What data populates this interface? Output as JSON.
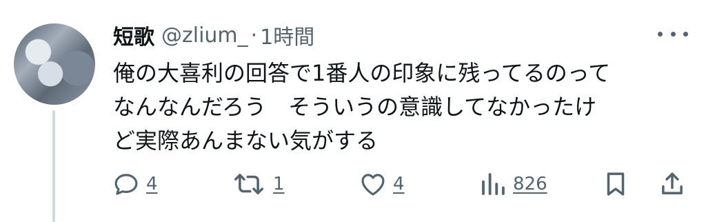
{
  "tweet": {
    "display_name": "短歌",
    "handle": "@zlium_",
    "separator": "·",
    "time": "1時間",
    "text": "俺の大喜利の回答で1番人の印象に残ってるのって\nなんなんだろう　そういうの意識してなかったけ\nど実際あんまない気がする"
  },
  "actions": {
    "reply_count": "4",
    "retweet_count": "1",
    "like_count": "4",
    "views_count": "826"
  },
  "icons": {
    "avatar": "avatar-image",
    "more": "more-options-icon",
    "reply": "reply-icon",
    "retweet": "retweet-icon",
    "like": "heart-icon",
    "views": "views-icon",
    "bookmark": "bookmark-icon",
    "share": "share-icon"
  },
  "colors": {
    "text": "#0f1419",
    "secondary": "#536471",
    "thread_line": "#cfd9de"
  }
}
